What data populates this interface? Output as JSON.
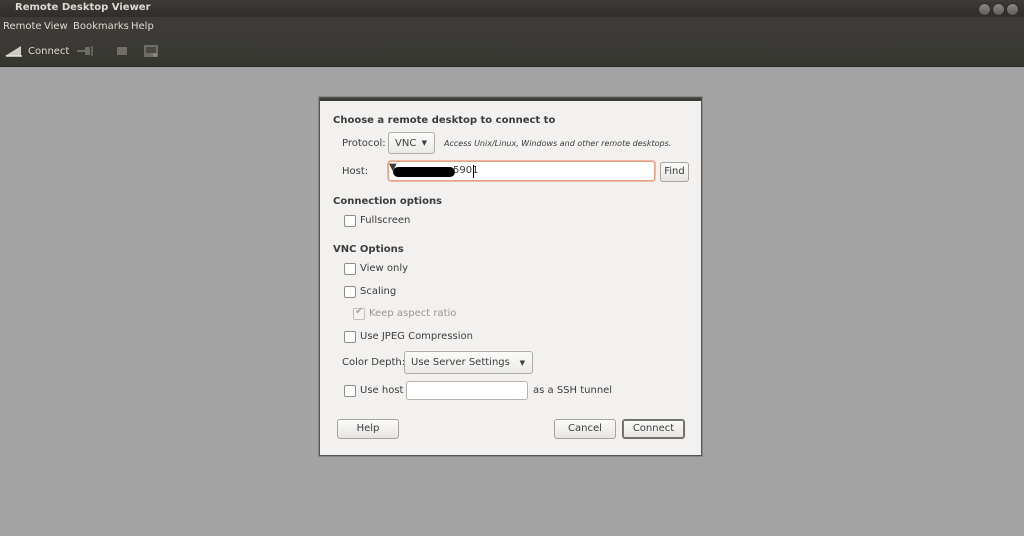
{
  "window": {
    "title": "Remote Desktop Viewer"
  },
  "menubar": [
    "Remote",
    "View",
    "Bookmarks",
    "Help"
  ],
  "toolbar": {
    "connect_label": "Connect",
    "icons": [
      "connect-icon",
      "disconnect-icon",
      "fullscreen-icon",
      "screenshot-icon"
    ]
  },
  "dialog": {
    "heading": "Choose a remote desktop to connect to",
    "protocol": {
      "label": "Protocol:",
      "value": "VNC",
      "description": "Access Unix/Linux, Windows and other remote desktops."
    },
    "host": {
      "label": "Host:",
      "value_visible": "5901",
      "find_label": "Find"
    },
    "connection_options": {
      "heading": "Connection options",
      "fullscreen_label": "Fullscreen",
      "fullscreen_checked": false
    },
    "vnc_options": {
      "heading": "VNC Options",
      "view_only_label": "View only",
      "view_only_checked": false,
      "scaling_label": "Scaling",
      "scaling_checked": false,
      "keep_aspect_label": "Keep aspect ratio",
      "keep_aspect_checked": true,
      "keep_aspect_enabled": false,
      "jpeg_label": "Use JPEG Compression",
      "jpeg_checked": false,
      "color_depth_label": "Color Depth:",
      "color_depth_value": "Use Server Settings",
      "use_host_label": "Use host",
      "use_host_checked": false,
      "use_host_value": "",
      "ssh_suffix": "as a SSH tunnel"
    },
    "buttons": {
      "help": "Help",
      "cancel": "Cancel",
      "connect": "Connect"
    }
  },
  "colors": {
    "desktop_bg": "#a3a3a3",
    "chrome_dark": "#3c3b37",
    "dialog_bg": "#f2f1f0",
    "focus_accent": "#e95420"
  }
}
